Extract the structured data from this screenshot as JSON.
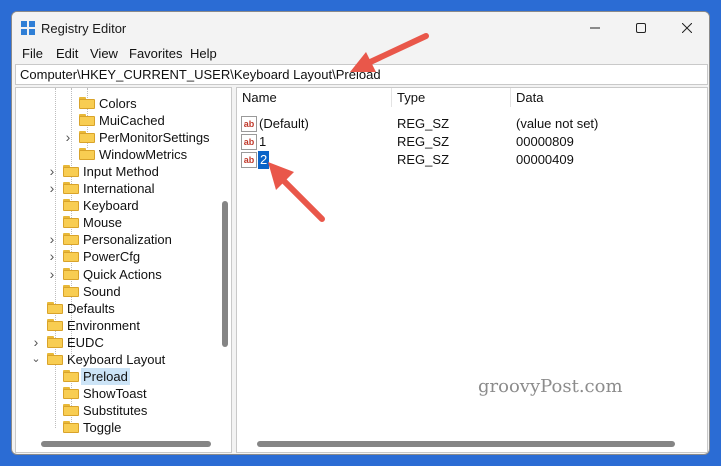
{
  "window": {
    "title": "Registry Editor",
    "controls": {
      "minimize_icon": "minimize-icon",
      "maximize_icon": "maximize-icon",
      "close_icon": "close-icon"
    }
  },
  "menubar": {
    "items": [
      "File",
      "Edit",
      "View",
      "Favorites",
      "Help"
    ]
  },
  "address": "Computer\\HKEY_CURRENT_USER\\Keyboard Layout\\Preload",
  "tree": {
    "items": [
      {
        "label": "Colors",
        "level": 3,
        "expander": false,
        "selected": false
      },
      {
        "label": "MuiCached",
        "level": 3,
        "expander": false,
        "selected": false
      },
      {
        "label": "PerMonitorSettings",
        "level": 3,
        "expander": true,
        "selected": false
      },
      {
        "label": "WindowMetrics",
        "level": 3,
        "expander": false,
        "selected": false
      },
      {
        "label": "Input Method",
        "level": 2,
        "expander": true,
        "selected": false
      },
      {
        "label": "International",
        "level": 2,
        "expander": true,
        "selected": false
      },
      {
        "label": "Keyboard",
        "level": 2,
        "expander": false,
        "selected": false
      },
      {
        "label": "Mouse",
        "level": 2,
        "expander": false,
        "selected": false
      },
      {
        "label": "Personalization",
        "level": 2,
        "expander": true,
        "selected": false
      },
      {
        "label": "PowerCfg",
        "level": 2,
        "expander": true,
        "selected": false
      },
      {
        "label": "Quick Actions",
        "level": 2,
        "expander": true,
        "selected": false
      },
      {
        "label": "Sound",
        "level": 2,
        "expander": false,
        "selected": false
      },
      {
        "label": "Defaults",
        "level": 1,
        "expander": false,
        "selected": false
      },
      {
        "label": "Environment",
        "level": 1,
        "expander": false,
        "selected": false
      },
      {
        "label": "EUDC",
        "level": 1,
        "expander": true,
        "selected": false
      },
      {
        "label": "Keyboard Layout",
        "level": 1,
        "expander": "open",
        "selected": false
      },
      {
        "label": "Preload",
        "level": 2,
        "expander": false,
        "selected": true
      },
      {
        "label": "ShowToast",
        "level": 2,
        "expander": false,
        "selected": false
      },
      {
        "label": "Substitutes",
        "level": 2,
        "expander": false,
        "selected": false
      },
      {
        "label": "Toggle",
        "level": 2,
        "expander": false,
        "selected": false
      }
    ]
  },
  "list": {
    "columns": [
      "Name",
      "Type",
      "Data"
    ],
    "rows": [
      {
        "name": "(Default)",
        "type": "REG_SZ",
        "data": "(value not set)",
        "selected": false
      },
      {
        "name": "1",
        "type": "REG_SZ",
        "data": "00000809",
        "selected": false
      },
      {
        "name": "2",
        "type": "REG_SZ",
        "data": "00000409",
        "selected": true
      }
    ],
    "value_icon_text": "ab"
  },
  "watermark": "groovyPost.com",
  "colors": {
    "desktop": "#2b6cd4",
    "arrow": "#e9574a",
    "selection": "#0a64c8",
    "folder": "#f8cd52"
  }
}
